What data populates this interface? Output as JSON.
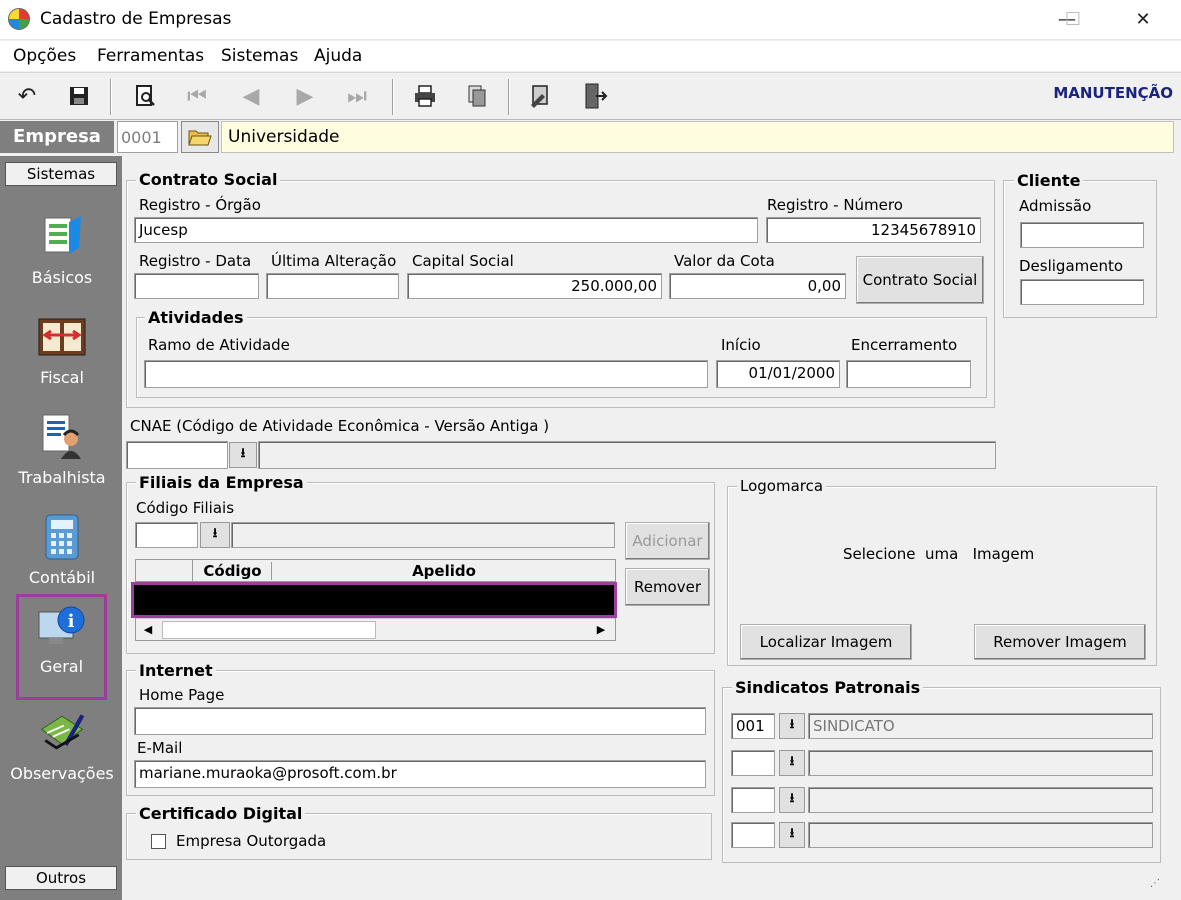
{
  "window": {
    "title": "Cadastro de Empresas",
    "minimize": "—",
    "maximize": "☐",
    "close": "✕"
  },
  "menu": {
    "items": [
      "Opções",
      "Ferramentas",
      "Sistemas",
      "Ajuda"
    ]
  },
  "toolbar": {
    "mode_label": "MANUTENÇÃO"
  },
  "empresa": {
    "label": "Empresa",
    "code": "0001",
    "name": "Universidade"
  },
  "sidebar": {
    "header": "Sistemas",
    "items": [
      "Básicos",
      "Fiscal",
      "Trabalhista",
      "Contábil",
      "Geral",
      "Observações"
    ],
    "selected": "Geral",
    "footer": "Outros"
  },
  "contrato": {
    "title": "Contrato Social",
    "registro_orgao_label": "Registro - Órgão",
    "registro_orgao": "Jucesp",
    "registro_numero_label": "Registro - Número",
    "registro_numero": "12345678910",
    "registro_data_label": "Registro - Data",
    "registro_data": "",
    "ultima_alteracao_label": "Última Alteração",
    "ultima_alteracao": "",
    "capital_social_label": "Capital Social",
    "capital_social": "250.000,00",
    "valor_cota_label": "Valor da Cota",
    "valor_cota": "0,00",
    "contrato_button": "Contrato Social"
  },
  "atividades": {
    "title": "Atividades",
    "ramo_label": "Ramo de Atividade",
    "ramo": "",
    "inicio_label": "Início",
    "inicio": "01/01/2000",
    "encerramento_label": "Encerramento",
    "encerramento": ""
  },
  "cliente": {
    "title": "Cliente",
    "admissao_label": "Admissão",
    "admissao": "",
    "desligamento_label": "Desligamento",
    "desligamento": ""
  },
  "cnae": {
    "label": "CNAE (Código de Atividade Econômica - Versão Antiga )",
    "value": ""
  },
  "filiais": {
    "title": "Filiais da Empresa",
    "codigo_label": "Código Filiais",
    "codigo": "",
    "add_button": "Adicionar",
    "remove_button": "Remover",
    "columns": [
      "Código",
      "Apelido"
    ]
  },
  "logomarca": {
    "title": "Logomarca",
    "placeholder": "Selecione  uma   Imagem",
    "localizar_button": "Localizar Imagem",
    "remover_button": "Remover Imagem"
  },
  "internet": {
    "title": "Internet",
    "home_page_label": "Home Page",
    "home_page": "",
    "email_label": "E-Mail",
    "email": "mariane.muraoka@prosoft.com.br"
  },
  "certificado": {
    "title": "Certificado Digital",
    "outorgada_label": "Empresa Outorgada",
    "outorgada_checked": false
  },
  "sindicatos": {
    "title": "Sindicatos Patronais",
    "rows": [
      {
        "code": "001",
        "name": "SINDICATO"
      },
      {
        "code": "",
        "name": ""
      },
      {
        "code": "",
        "name": ""
      },
      {
        "code": "",
        "name": ""
      }
    ]
  },
  "colors": {
    "mode_label": "#1a237e",
    "selection_border": "#9c3f9c",
    "empresa_name_bg": "#fffde0",
    "sidebar_bg": "#7f7f7f"
  }
}
